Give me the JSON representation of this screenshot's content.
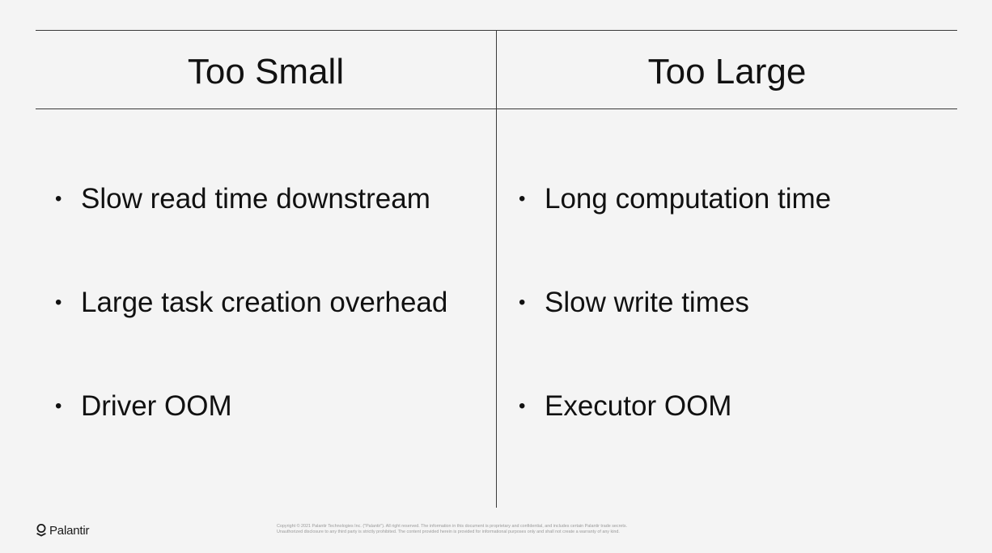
{
  "slide": {
    "left_column": {
      "heading": "Too Small",
      "bullets": [
        "Slow read time downstream",
        "Large task creation overhead",
        "Driver OOM"
      ]
    },
    "right_column": {
      "heading": "Too Large",
      "bullets": [
        "Long computation time",
        "Slow write times",
        "Executor OOM"
      ]
    },
    "bullet_glyph": "•"
  },
  "footer": {
    "logo_text": "Palantir",
    "logo_icon": "palantir-logo-icon",
    "copyright_line1": "Copyright © 2021 Palantir Technologies Inc. (\"Palantir\"). All right reserved. The information in this document is proprietary and confidential, and includes certain Palantir trade secrets.",
    "copyright_line2": "Unauthorized disclosure to any third party is strictly prohibited. The content provided herein is provided for informational purposes only and shall not create a warranty of any kind."
  },
  "colors": {
    "background": "#f4f4f4",
    "text": "#111111",
    "rule": "#3a3a3a",
    "fine_print": "#9a9a9a"
  }
}
